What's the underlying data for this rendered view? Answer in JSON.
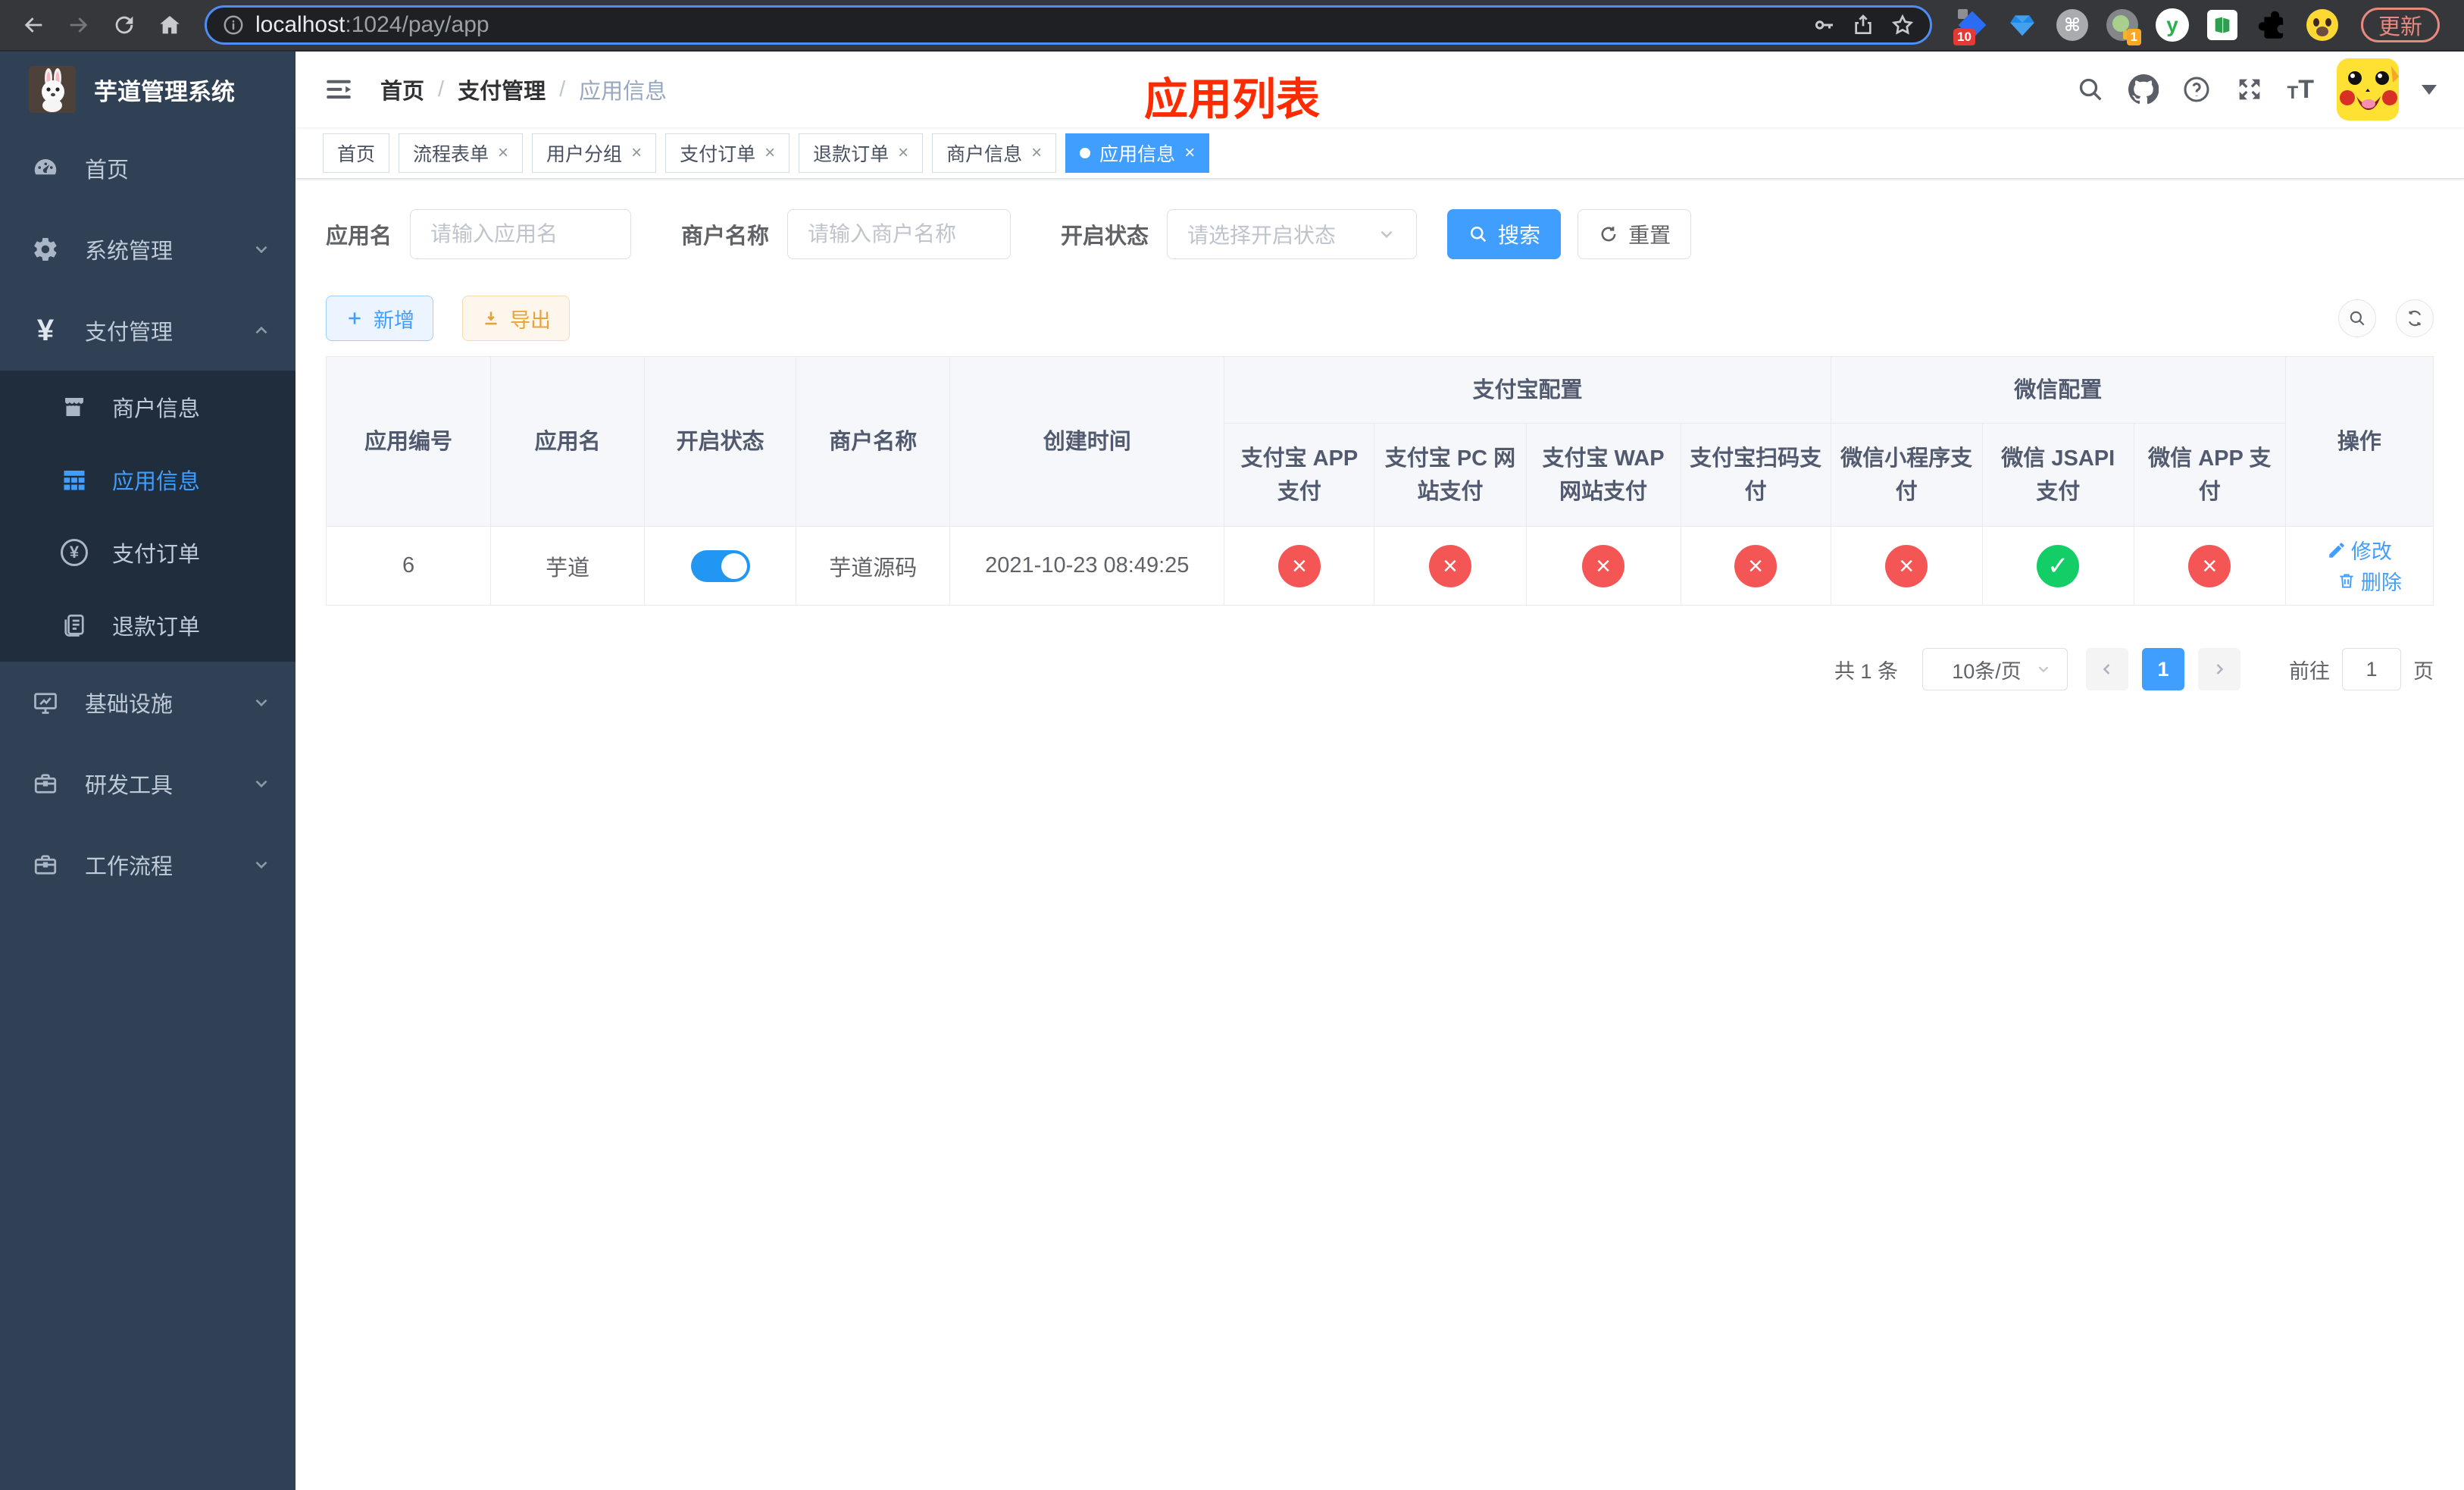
{
  "browser": {
    "url_host": "localhost",
    "url_rest": ":1024/pay/app",
    "update_label": "更新",
    "ext_badge_a": "10",
    "ext_badge_b": "1"
  },
  "sidebar": {
    "logo_title": "芋道管理系统",
    "items": [
      {
        "label": "首页"
      },
      {
        "label": "系统管理"
      },
      {
        "label": "支付管理"
      },
      {
        "label": "商户信息"
      },
      {
        "label": "应用信息"
      },
      {
        "label": "支付订单"
      },
      {
        "label": "退款订单"
      },
      {
        "label": "基础设施"
      },
      {
        "label": "研发工具"
      },
      {
        "label": "工作流程"
      }
    ]
  },
  "header": {
    "breadcrumb": [
      "首页",
      "支付管理",
      "应用信息"
    ],
    "annotation": "应用列表"
  },
  "tags": [
    {
      "label": "首页"
    },
    {
      "label": "流程表单"
    },
    {
      "label": "用户分组"
    },
    {
      "label": "支付订单"
    },
    {
      "label": "退款订单"
    },
    {
      "label": "商户信息"
    },
    {
      "label": "应用信息"
    }
  ],
  "filters": {
    "app_name_label": "应用名",
    "app_name_placeholder": "请输入应用名",
    "merchant_label": "商户名称",
    "merchant_placeholder": "请输入商户名称",
    "status_label": "开启状态",
    "status_placeholder": "请选择开启状态",
    "search_label": "搜索",
    "reset_label": "重置"
  },
  "toolbar": {
    "add_label": "新增",
    "export_label": "导出"
  },
  "table": {
    "columns": [
      "应用编号",
      "应用名",
      "开启状态",
      "商户名称",
      "创建时间"
    ],
    "group_alipay": "支付宝配置",
    "group_wechat": "微信配置",
    "sub_columns": [
      "支付宝 APP 支付",
      "支付宝 PC 网站支付",
      "支付宝 WAP 网站支付",
      "支付宝扫码支付",
      "微信小程序支付",
      "微信 JSAPI 支付",
      "微信 APP 支付"
    ],
    "action_column": "操作",
    "row": {
      "id": "6",
      "name": "芋道",
      "enabled": true,
      "merchant": "芋道源码",
      "created": "2021-10-23 08:49:25",
      "statuses": [
        "fail",
        "fail",
        "fail",
        "fail",
        "fail",
        "success",
        "fail"
      ],
      "edit_label": "修改",
      "delete_label": "删除"
    }
  },
  "pagination": {
    "total_text": "共 1 条",
    "page_size": "10条/页",
    "current_page": "1",
    "goto_label": "前往",
    "goto_value": "1",
    "page_suffix": "页"
  },
  "colors": {
    "primary": "#409eff",
    "success": "#13ce66",
    "danger": "#f45656",
    "warning": "#e6a23c",
    "annotation": "#ff2b00"
  }
}
